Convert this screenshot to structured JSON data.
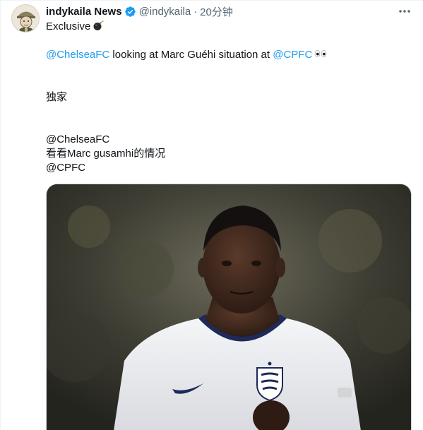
{
  "tweet": {
    "display_name": "indykaila News",
    "handle": "@indykaila",
    "separator": "·",
    "time": "20分钟",
    "lines": {
      "exclusive": "Exclusive",
      "mention_chelsea": "@ChelseaFC",
      "situation_text": " looking at Marc Guéhi situation at ",
      "mention_cpfc": "@CPFC",
      "chinese_exclusive": "独家",
      "cn_mention_chelsea": "@ChelseaFC",
      "cn_situation": "看看Marc gusamhi的情况",
      "cn_mention_cpfc": "@CPFC"
    },
    "icons": {
      "verified": "verified-badge-icon",
      "more": "more-options-icon",
      "bomb": "bomb-emoji",
      "eyes": "eyes-emoji"
    },
    "colors": {
      "link": "#1d9bf0",
      "text": "#0f1419",
      "secondary": "#536471",
      "border": "#cfd9de"
    }
  }
}
